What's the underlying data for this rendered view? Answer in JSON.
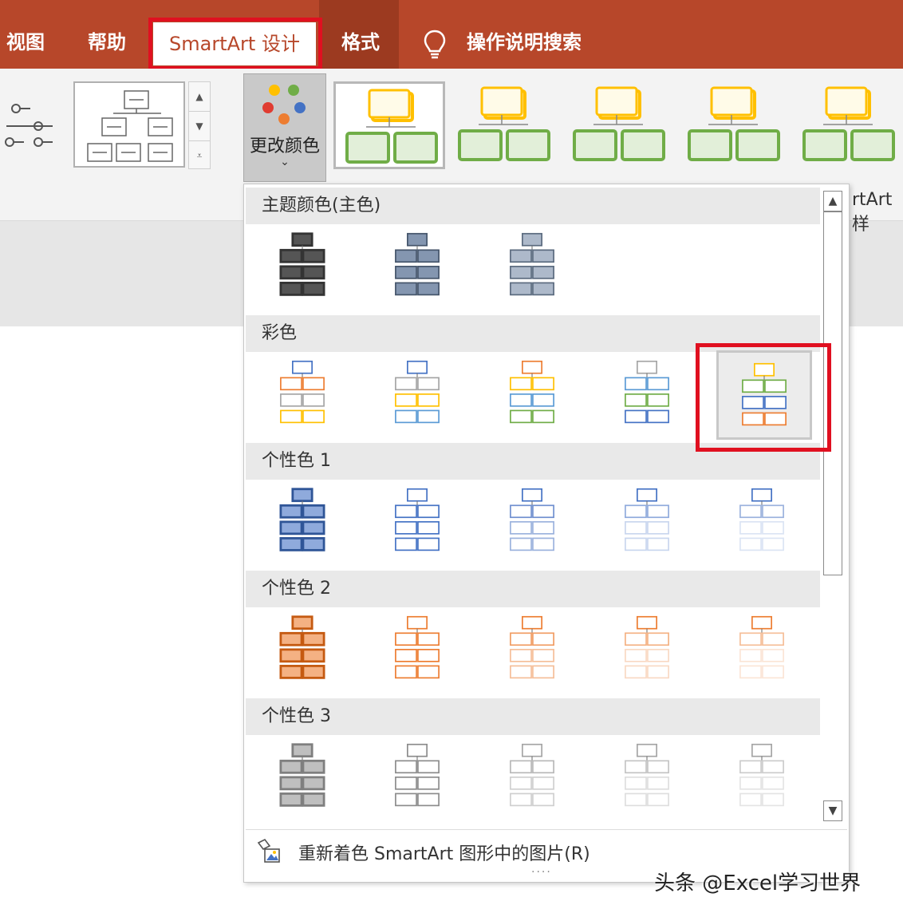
{
  "tabs": {
    "view": "视图",
    "help": "帮助",
    "smartart_design": "SmartArt 设计",
    "format": "格式",
    "tell_me": "操作说明搜索"
  },
  "ribbon": {
    "change_colors_label": "更改颜色",
    "right_cut_text": "rtArt 样",
    "colors": {
      "yellow": "#ffc000",
      "green": "#70ad47"
    }
  },
  "dropdown": {
    "sections": [
      {
        "header": "主题颜色(主色)",
        "swatches": [
          {
            "top": "#333333",
            "mid": "#333333",
            "low": "#333333",
            "fill": "#555555"
          },
          {
            "top": "#44546a",
            "mid": "#44546a",
            "low": "#44546a",
            "fill": "#8496b0"
          },
          {
            "top": "#5a6a7e",
            "mid": "#5a6a7e",
            "low": "#5a6a7e",
            "fill": "#adb9ca"
          }
        ]
      },
      {
        "header": "彩色",
        "swatches": [
          {
            "top": "#4472c4",
            "mid": "#ed7d31",
            "low": "#a5a5a5",
            "bottom": "#ffc000",
            "fill": "#ffffff"
          },
          {
            "top": "#4472c4",
            "mid": "#a5a5a5",
            "low": "#ffc000",
            "bottom": "#5b9bd5",
            "fill": "#ffffff"
          },
          {
            "top": "#ed7d31",
            "mid": "#ffc000",
            "low": "#5b9bd5",
            "bottom": "#70ad47",
            "fill": "#ffffff"
          },
          {
            "top": "#a5a5a5",
            "mid": "#5b9bd5",
            "low": "#70ad47",
            "bottom": "#4472c4",
            "fill": "#ffffff"
          },
          {
            "top": "#ffc000",
            "mid": "#70ad47",
            "low": "#4472c4",
            "bottom": "#ed7d31",
            "fill": "#ffffff"
          }
        ]
      },
      {
        "header": "个性色 1",
        "swatches": [
          {
            "top": "#2f5597",
            "mid": "#2f5597",
            "low": "#2f5597",
            "fill": "#8faadc"
          },
          {
            "top": "#4472c4",
            "mid": "#4472c4",
            "low": "#4472c4",
            "fill": "#ffffff"
          },
          {
            "top": "#4472c4",
            "mid": "#6f8fcf",
            "low": "#9bb2dd",
            "fill": "#ffffff"
          },
          {
            "top": "#4472c4",
            "mid": "#8faadc",
            "low": "#c9d6ee",
            "fill": "#ffffff"
          },
          {
            "top": "#4472c4",
            "mid": "#9bb2dd",
            "low": "#dbe4f4",
            "fill": "#ffffff"
          }
        ]
      },
      {
        "header": "个性色 2",
        "swatches": [
          {
            "top": "#c55a11",
            "mid": "#c55a11",
            "low": "#c55a11",
            "fill": "#f4b183"
          },
          {
            "top": "#ed7d31",
            "mid": "#ed7d31",
            "low": "#ed7d31",
            "fill": "#ffffff"
          },
          {
            "top": "#ed7d31",
            "mid": "#f19c62",
            "low": "#f5be98",
            "fill": "#ffffff"
          },
          {
            "top": "#ed7d31",
            "mid": "#f4b183",
            "low": "#f9d9c3",
            "fill": "#ffffff"
          },
          {
            "top": "#ed7d31",
            "mid": "#f5be98",
            "low": "#fbe5d6",
            "fill": "#ffffff"
          }
        ]
      },
      {
        "header": "个性色 3",
        "swatches": [
          {
            "top": "#7f7f7f",
            "mid": "#7f7f7f",
            "low": "#7f7f7f",
            "fill": "#bfbfbf"
          },
          {
            "top": "#8c8c8c",
            "mid": "#8c8c8c",
            "low": "#8c8c8c",
            "fill": "#ffffff"
          },
          {
            "top": "#a5a5a5",
            "mid": "#b8b8b8",
            "low": "#cfcfcf",
            "fill": "#ffffff"
          },
          {
            "top": "#a5a5a5",
            "mid": "#c4c4c4",
            "low": "#dedede",
            "fill": "#ffffff"
          },
          {
            "top": "#a5a5a5",
            "mid": "#cccccc",
            "low": "#e4e4e4",
            "fill": "#ffffff"
          }
        ]
      }
    ],
    "recolor_label": "重新着色 SmartArt 图形中的图片(R)"
  },
  "watermark": "头条 @Excel学习世界"
}
